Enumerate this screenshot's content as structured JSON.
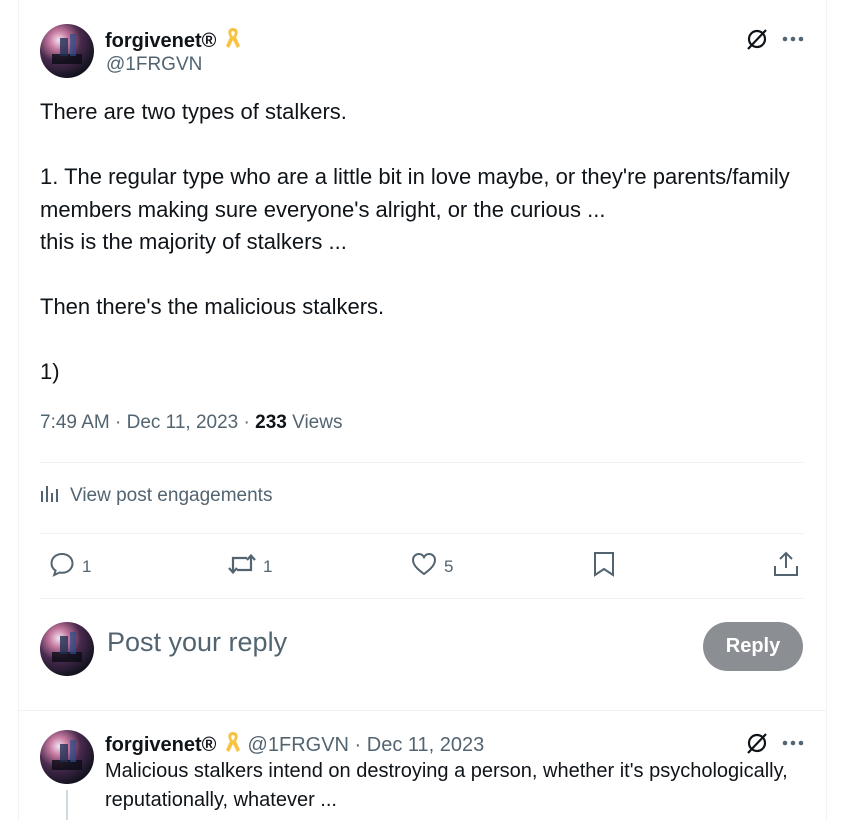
{
  "post": {
    "author_name": "forgivenet®",
    "author_handle": "@1FRGVN",
    "body": "There are two types of stalkers.\n\n1. The regular type who are a little bit in love maybe, or they're parents/family members making sure everyone's alright, or the curious ...\nthis is the majority of stalkers ...\n\nThen there's the malicious stalkers.\n\n1)",
    "time": "7:49 AM",
    "date": "Dec 11, 2023",
    "views_count": "233",
    "views_label": "Views",
    "engagements_label": "View post engagements"
  },
  "actions": {
    "reply_count": "1",
    "repost_count": "1",
    "like_count": "5"
  },
  "composer": {
    "placeholder": "Post your reply",
    "reply_label": "Reply"
  },
  "reply": {
    "author_name": "forgivenet®",
    "author_handle": "@1FRGVN",
    "date": "Dec 11, 2023",
    "body": "Malicious stalkers intend on destroying a person, whether it's psychologically, reputationally, whatever ..."
  },
  "colors": {
    "text": "#0f1419",
    "muted": "#536471",
    "divider": "#eff3f4",
    "reply_button": "#8b8f93",
    "ribbon": "#f6c343"
  },
  "icons": {
    "ribbon": "awareness-ribbon-icon",
    "grok": "grok-icon",
    "more": "more-dots-icon",
    "engagements": "bar-chart-icon",
    "reply": "comment-icon",
    "repost": "repost-icon",
    "like": "heart-icon",
    "bookmark": "bookmark-icon",
    "share": "share-icon"
  }
}
